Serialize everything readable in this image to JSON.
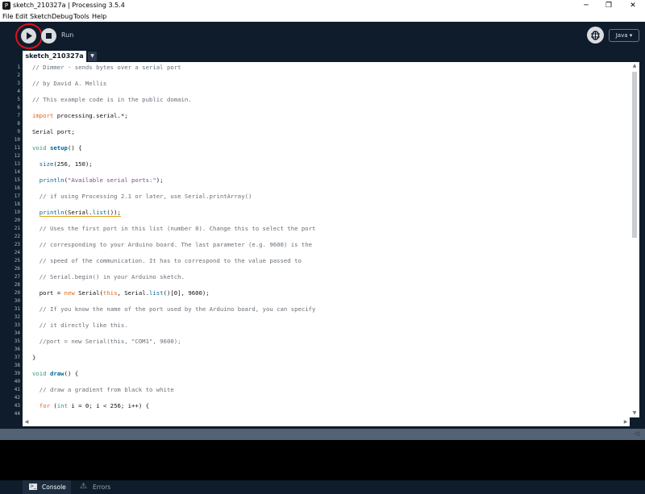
{
  "window": {
    "title": "sketch_210327a | Processing 3.5.4",
    "app_icon_glyph": "P",
    "minimize_glyph": "─",
    "maximize_glyph": "❐",
    "close_glyph": "✕"
  },
  "menu": [
    "File",
    "Edit",
    "Sketch",
    "Debug",
    "Tools",
    "Help"
  ],
  "toolbar": {
    "run_label": "Run",
    "mode": "Java ▾"
  },
  "tabs": {
    "active": "sketch_210327a",
    "menu_glyph": "▼"
  },
  "editor": {
    "line_count": 44,
    "code_lines": [
      "// Dimmer - sends bytes over a serial port",
      "// by David A. Mellis",
      "// This example code is in the public domain.",
      "import processing.serial.*;",
      "Serial port;",
      "void setup() {",
      "  size(256, 150);",
      "  println(\"Available serial ports:\");",
      "  // if using Processing 2.1 or later, use Serial.printArray()",
      "  println(Serial.list());",
      "  // Uses the first port in this list (number 0). Change this to select the port",
      "  // corresponding to your Arduino board. The last parameter (e.g. 9600) is the",
      "  // speed of the communication. It has to correspond to the value passed to",
      "  // Serial.begin() in your Arduino sketch.",
      "  port = new Serial(this, Serial.list()[0], 9600);",
      "  // If you know the name of the port used by the Arduino board, you can specify",
      "  // it directly like this.",
      "  //port = new Serial(this, \"COM1\", 9600);",
      "}",
      "void draw() {",
      "  // draw a gradient from black to white",
      "  for (int i = 0; i < 256; i++) {"
    ]
  },
  "status": {
    "collapse_glyph": "◁"
  },
  "footer": {
    "console_label": "Console",
    "errors_label": "Errors",
    "console_icon_glyph": ">_",
    "errors_icon_glyph": "⚠"
  },
  "colors": {
    "chrome": "#0e1c2b",
    "run_highlight": "#e0101c",
    "comment": "#666f78",
    "keyword": "#e2661a",
    "function": "#006699",
    "string": "#7d4793"
  }
}
